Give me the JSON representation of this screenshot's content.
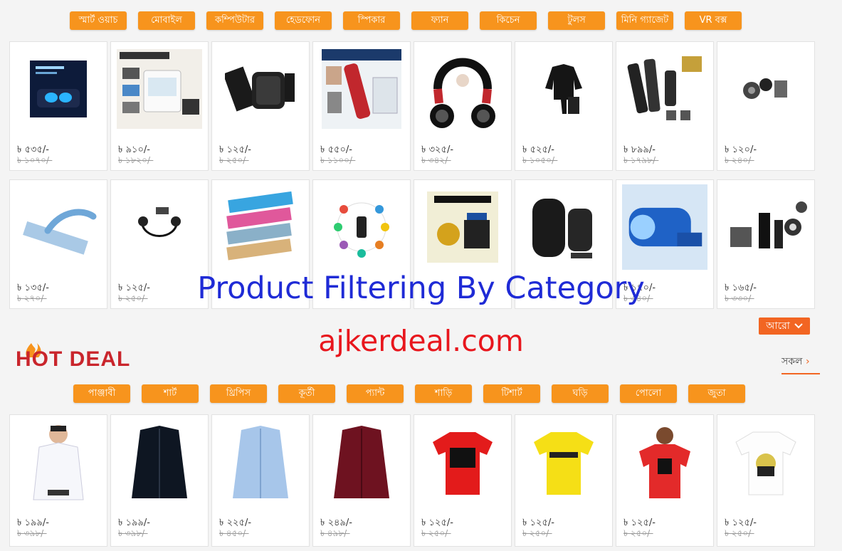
{
  "colors": {
    "accent": "#f7941d",
    "more_button": "#f26522",
    "hot_deal": "#c9252c",
    "overlay_title": "#1f2bd6",
    "overlay_domain": "#e8161d"
  },
  "top_tabs": [
    "স্মার্ট ওয়াচ",
    "মোবাইল",
    "কম্পিউটার",
    "হেডফোন",
    "স্পিকার",
    "ফ্যান",
    "কিচেন",
    "টুলস",
    "মিনি গ্যাজেট",
    "VR বক্স"
  ],
  "gadget_row1": [
    {
      "image": "earbuds",
      "price": "৳ ৫৩৫/-",
      "old_price": "৳ ১০৭০/-"
    },
    {
      "image": "air-cooler",
      "price": "৳ ৯১০/-",
      "old_price": "৳ ১৮২০/-"
    },
    {
      "image": "smart-watch",
      "price": "৳ ১২৫/-",
      "old_price": "৳ ২৫০/-"
    },
    {
      "image": "trimmer",
      "price": "৳ ৫৫০/-",
      "old_price": "৳ ১১০০/-"
    },
    {
      "image": "neck-fan",
      "price": "৳ ৩২৫/-",
      "old_price": "৳ ৩৪২/-"
    },
    {
      "image": "raincoat",
      "price": "৳ ৫২৫/-",
      "old_price": "৳ ১০৫০/-"
    },
    {
      "image": "grooming-kit",
      "price": "৳ ৮৯৯/-",
      "old_price": "৳ ১৭৯৮/-"
    },
    {
      "image": "gadget",
      "price": "৳ ১২০/-",
      "old_price": "৳ ২৪০/-"
    }
  ],
  "gadget_row2": [
    {
      "image": "squeegee",
      "price": "৳ ১৩৫/-",
      "old_price": "৳ ২৭০/-"
    },
    {
      "image": "bluetooth-earphone",
      "price": "৳ ১২৫/-",
      "old_price": "৳ ২৫০/-"
    },
    {
      "image": "power-bank",
      "price": "",
      "old_price": ""
    },
    {
      "image": "fitness-band",
      "price": "",
      "old_price": ""
    },
    {
      "image": "water-pump",
      "price": "",
      "old_price": ""
    },
    {
      "image": "backpack",
      "price": "",
      "old_price": ""
    },
    {
      "image": "torch-light",
      "price": "৳ ১৭০/-",
      "old_price": "৳ ৩৪০/-"
    },
    {
      "image": "flashlight",
      "price": "৳ ১৬৫/-",
      "old_price": "৳ ৩৩০/-"
    }
  ],
  "more_button": "আরো",
  "hot_deal": {
    "logo_text": "HOT DEAL",
    "see_all": "সকল"
  },
  "bottom_tabs": [
    "পাঞ্জাবী",
    "শার্ট",
    "থ্রিপিস",
    "কূর্তী",
    "প্যান্ট",
    "শাড়ি",
    "টিশার্ট",
    "ঘড়ি",
    "পোলো",
    "জুতা"
  ],
  "fashion_row": [
    {
      "image": "white-shirt",
      "price": "৳ ১৯৯/-",
      "old_price": "৳ ৩৯৮/-"
    },
    {
      "image": "black-shirt",
      "price": "৳ ১৯৯/-",
      "old_price": "৳ ৩৯৮/-"
    },
    {
      "image": "blue-shirt",
      "price": "৳ ২২৫/-",
      "old_price": "৳ ৪৫০/-"
    },
    {
      "image": "maroon-shirt",
      "price": "৳ ২৪৯/-",
      "old_price": "৳ ৪৯৮/-"
    },
    {
      "image": "red-tshirt",
      "price": "৳ ১২৫/-",
      "old_price": "৳ ২৫০/-"
    },
    {
      "image": "yellow-tshirt",
      "price": "৳ ১২৫/-",
      "old_price": "৳ ২৫০/-"
    },
    {
      "image": "red-tshirt-man",
      "price": "৳ ১২৫/-",
      "old_price": "৳ ২৫০/-"
    },
    {
      "image": "white-tshirt",
      "price": "৳ ১২৫/-",
      "old_price": "৳ ২৫০/-"
    }
  ],
  "overlay": {
    "title": "Product Filtering By Category",
    "domain": "ajkerdeal.com"
  }
}
